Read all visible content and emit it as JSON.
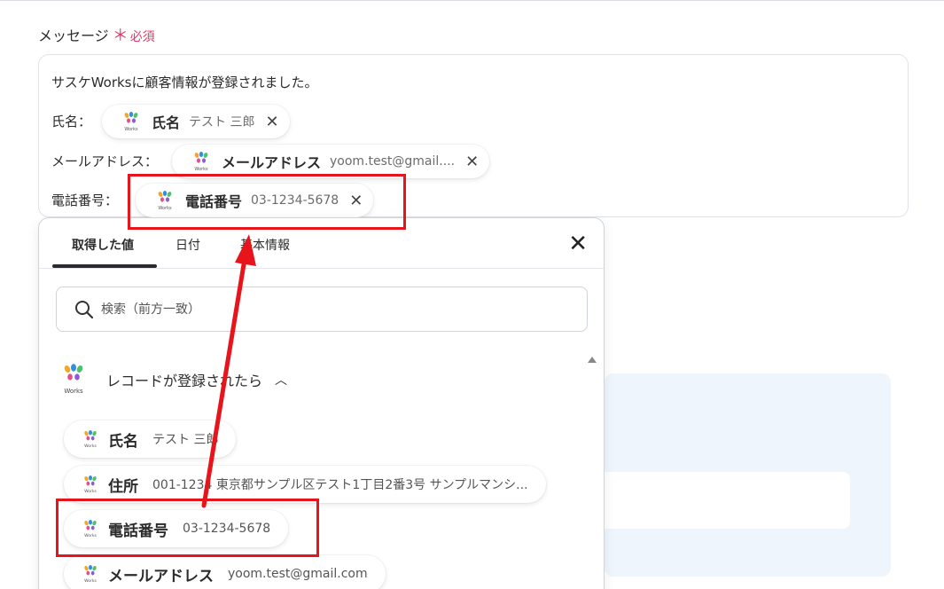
{
  "field": {
    "label": "メッセージ",
    "required_star": "＊",
    "required_text": "必須"
  },
  "message": {
    "line1": "サスケWorksに顧客情報が登録されました。",
    "rows": [
      {
        "label": "氏名：",
        "chip_name": "氏名",
        "chip_value": "テスト 三郎"
      },
      {
        "label": "メールアドレス：",
        "chip_name": "メールアドレス",
        "chip_value": "yoom.test@gmail...."
      },
      {
        "label": "電話番号：",
        "chip_name": "電話番号",
        "chip_value": "03-1234-5678"
      }
    ],
    "remove_glyph": "✕"
  },
  "panel": {
    "tabs": [
      {
        "label": "取得した値",
        "active": true
      },
      {
        "label": "日付",
        "active": false
      },
      {
        "label": "基本情報",
        "active": false
      }
    ],
    "close_glyph": "✕",
    "search_placeholder": "検索（前方一致）",
    "section": {
      "logo_text": "Works",
      "title": "レコードが登録されたら",
      "chevron": "︿"
    },
    "items": [
      {
        "name": "氏名",
        "value": "テスト 三郎"
      },
      {
        "name": "住所",
        "value": "001-1234 東京都サンプル区テスト1丁目2番3号 サンプルマンシ..."
      },
      {
        "name": "電話番号",
        "value": "03-1234-5678"
      },
      {
        "name": "メールアドレス",
        "value": "yoom.test@gmail.com"
      }
    ]
  },
  "colors": {
    "required": "#e3366b",
    "highlight": "#e8141b",
    "arrow": "#e8141b",
    "bg_panel": "#eef5fd"
  },
  "icons": {
    "works_logo": "works-logo-icon",
    "search": "search-icon",
    "close": "close-icon",
    "remove": "remove-icon",
    "chevron_up": "chevron-up-icon",
    "scroll_up": "scroll-up-icon"
  }
}
